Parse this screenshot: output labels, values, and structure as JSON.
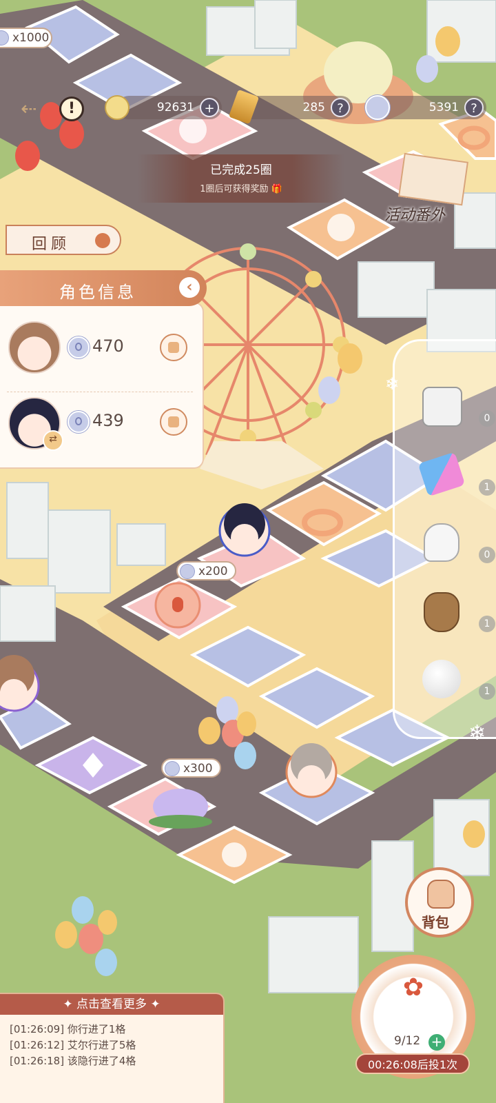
{
  "currency": {
    "gold": "92631",
    "gem": "285",
    "points": "5391"
  },
  "board_reward_top": "x1000",
  "lap_banner": {
    "completed": "已完成25圈",
    "hint": "1圈后可获得奖励"
  },
  "review_button": "回顾",
  "activity_button": "活动番外",
  "role_panel": {
    "title": "角色信息",
    "roles": [
      {
        "points": "470"
      },
      {
        "points": "439"
      }
    ]
  },
  "tile_rewards": [
    {
      "label": "x200"
    },
    {
      "label": "x300"
    }
  ],
  "items": [
    {
      "icon": "dice-icon",
      "count": "0"
    },
    {
      "icon": "swap-arrows-icon",
      "count": "1"
    },
    {
      "icon": "glove-icon",
      "count": "0"
    },
    {
      "icon": "sack-icon",
      "count": "1"
    },
    {
      "icon": "snowball-icon",
      "count": "1"
    }
  ],
  "backpack_label": "背包",
  "dice": {
    "count": "9/12",
    "timer": "00:26:08后投1次"
  },
  "log": {
    "header": "点击查看更多",
    "lines": [
      {
        "time": "[01:26:09]",
        "text": "你行进了1格"
      },
      {
        "time": "[01:26:12]",
        "text": "艾尔行进了5格"
      },
      {
        "time": "[01:26:18]",
        "text": "该隐行进了4格"
      }
    ]
  },
  "colors": {
    "accent": "#d2845a",
    "log_header": "#b55b49",
    "timer_bg": "#a4453b",
    "grass": "#9fbf6e",
    "road": "#7d6b6b",
    "tile_blue": "#b7c0e4",
    "tile_pink": "#f7c3c3",
    "tile_orange": "#f6c191"
  }
}
